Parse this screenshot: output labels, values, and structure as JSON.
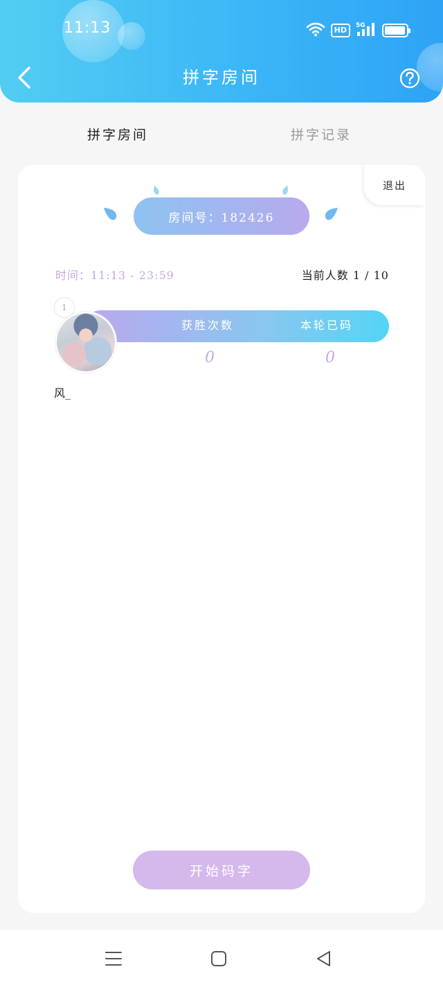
{
  "status_bar": {
    "time": "11:13",
    "hd_label": "HD",
    "network_label": "5G"
  },
  "header": {
    "title": "拼字房间"
  },
  "tabs": [
    {
      "label": "拼字房间",
      "active": true
    },
    {
      "label": "拼字记录",
      "active": false
    }
  ],
  "room": {
    "exit_label": "退出",
    "room_number_text": "房间号：182426",
    "time_text": "时间：11:13 - 23:59",
    "count_text": "当前人数 1 / 10"
  },
  "player": {
    "rank": "1",
    "name": "风_",
    "wins_label": "获胜次数",
    "typed_label": "本轮已码",
    "wins": "0",
    "typed": "0"
  },
  "actions": {
    "start_label": "开始码字"
  },
  "colors": {
    "header_start": "#52cdf2",
    "header_end": "#2ea3f6",
    "accent_purple": "#c8a7e3",
    "button_purple": "#d5b8ec",
    "drop_blue": "#6fb8f2"
  },
  "icons": {
    "back": "chevron-left-icon",
    "help": "question-circle-icon",
    "nav_menu": "menu-icon",
    "nav_home": "square-icon",
    "nav_back": "triangle-back-icon"
  }
}
